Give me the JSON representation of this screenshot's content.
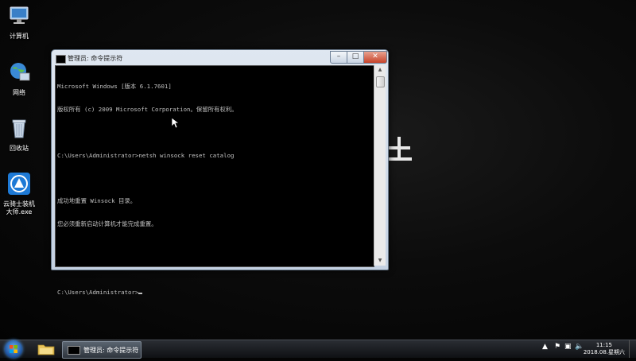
{
  "desktop": {
    "icons": [
      {
        "label": "计算机",
        "icon": "computer-icon"
      },
      {
        "label": "网络",
        "icon": "network-icon"
      },
      {
        "label": "回收站",
        "icon": "recycle-bin-icon"
      },
      {
        "label_line1": "云骑士装机",
        "label_line2": "大师.exe",
        "icon": "app-icon"
      }
    ]
  },
  "window": {
    "title": "管理员: 命令提示符",
    "console_lines": [
      "Microsoft Windows [版本 6.1.7601]",
      "版权所有 (c) 2009 Microsoft Corporation。保留所有权利。",
      "",
      "C:\\Users\\Administrator>netsh winsock reset catalog",
      "",
      "成功地重置 Winsock 目录。",
      "您必须重新启动计算机才能完成重置。",
      "",
      "",
      "C:\\Users\\Administrator>"
    ]
  },
  "taskbar": {
    "cmd_label": "管理员: 命令提示符",
    "time": "11:15",
    "date": "2018.08.星期六"
  }
}
